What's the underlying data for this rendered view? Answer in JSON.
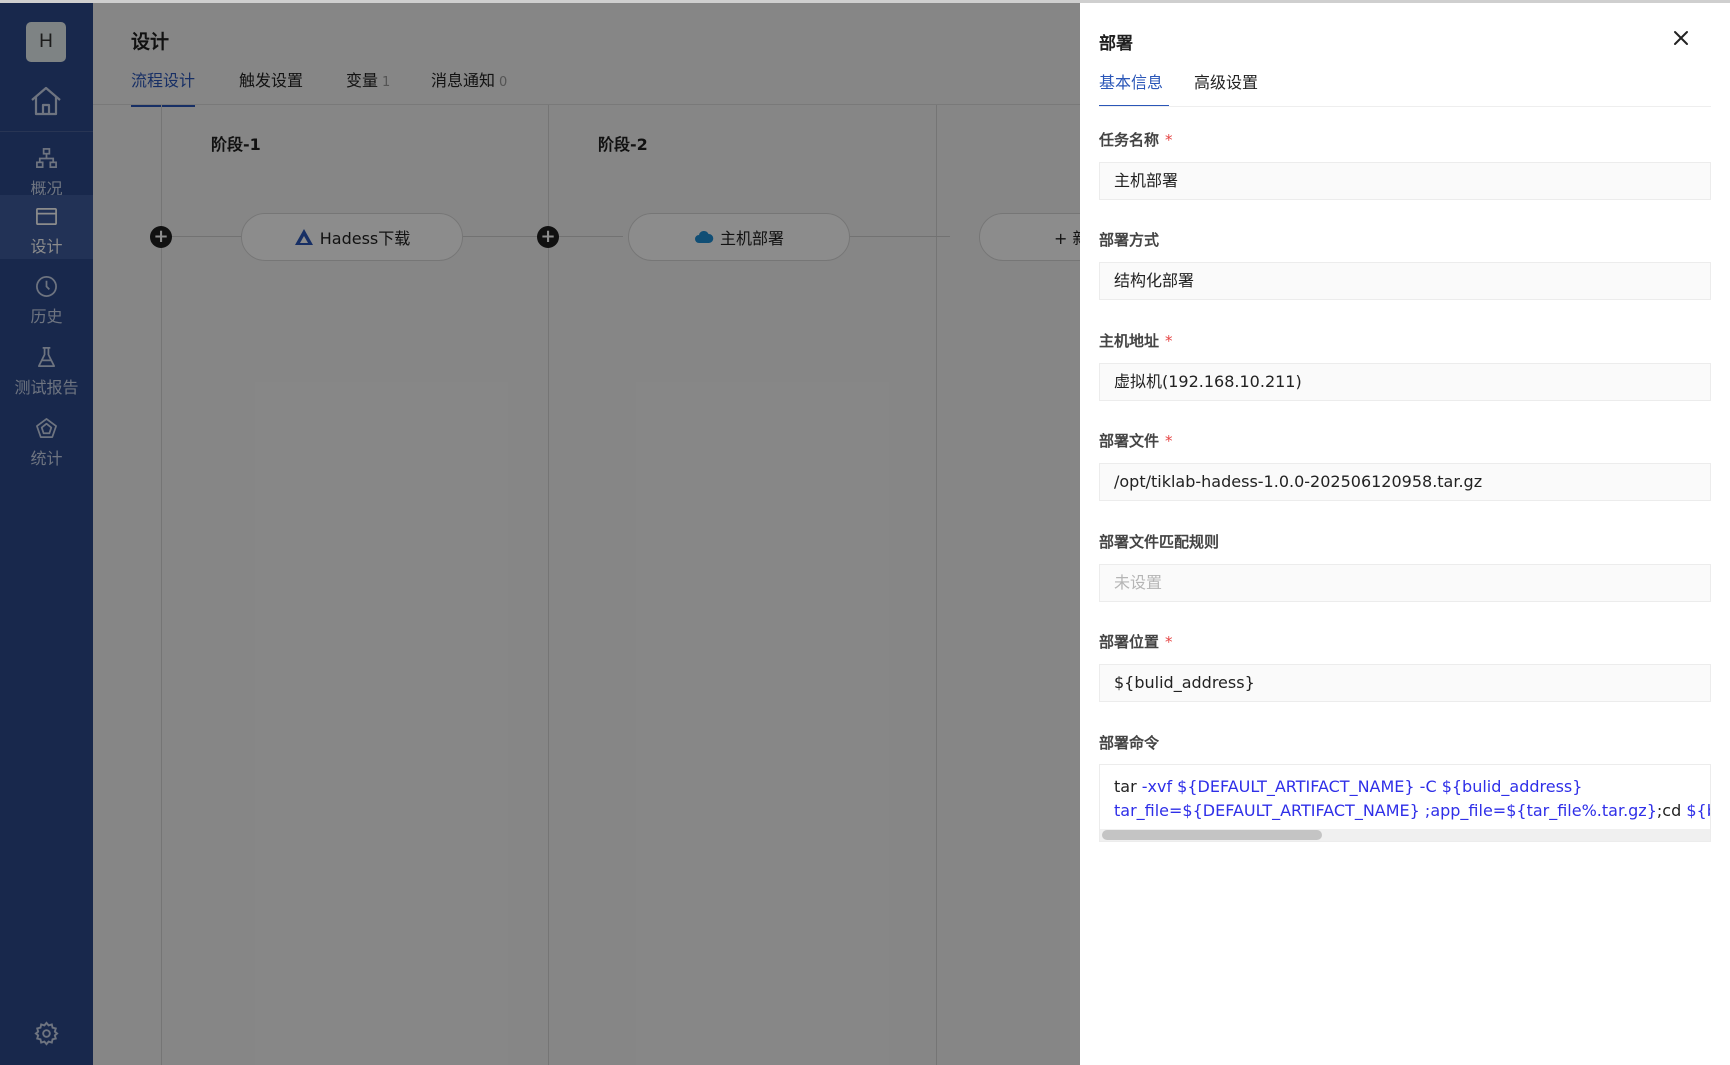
{
  "sidebar": {
    "logo_letter": "H",
    "items": [
      {
        "label": "概况",
        "icon": "sitemap-icon"
      },
      {
        "label": "设计",
        "icon": "card-icon"
      },
      {
        "label": "历史",
        "icon": "clock-icon"
      },
      {
        "label": "测试报告",
        "icon": "flask-icon"
      },
      {
        "label": "统计",
        "icon": "pentagon-icon"
      }
    ],
    "active": "设计"
  },
  "main": {
    "title": "设计",
    "tabs": [
      {
        "label": "流程设计",
        "count": ""
      },
      {
        "label": "触发设置",
        "count": ""
      },
      {
        "label": "变量",
        "count": "1"
      },
      {
        "label": "消息通知",
        "count": "0"
      }
    ],
    "stages": [
      {
        "title": "阶段-1",
        "task": "Hadess下载",
        "icon": "hadess-icon"
      },
      {
        "title": "阶段-2",
        "task": "主机部署",
        "icon": "cloud-icon"
      }
    ],
    "add_stage_label": "+ 新"
  },
  "drawer": {
    "title": "部署",
    "tabs": [
      "基本信息",
      "高级设置"
    ],
    "fields": [
      {
        "label": "任务名称",
        "required": true,
        "value": "主机部署"
      },
      {
        "label": "部署方式",
        "required": false,
        "value": "结构化部署"
      },
      {
        "label": "主机地址",
        "required": true,
        "value": "虚拟机(192.168.10.211)"
      },
      {
        "label": "部署文件",
        "required": true,
        "value": "/opt/tiklab-hadess-1.0.0-202506120958.tar.gz"
      },
      {
        "label": "部署文件匹配规则",
        "required": false,
        "value": "",
        "placeholder": "未设置"
      },
      {
        "label": "部署位置",
        "required": true,
        "value": "${bulid_address}"
      }
    ],
    "command": {
      "label": "部署命令",
      "line1_prefix": "tar",
      "line1_rest": " -xvf  ${DEFAULT_ARTIFACT_NAME} -C ${bulid_address}",
      "line2_a": "tar_file=${DEFAULT_ARTIFACT_NAME} ;app_file=${tar_file%.tar.gz}",
      "line2_b": ";cd ",
      "line2_c": "${bulid_a"
    }
  },
  "colors": {
    "sidebar_bg": "#2d4a8a",
    "accent": "#2a56b8",
    "required": "#e54646"
  }
}
